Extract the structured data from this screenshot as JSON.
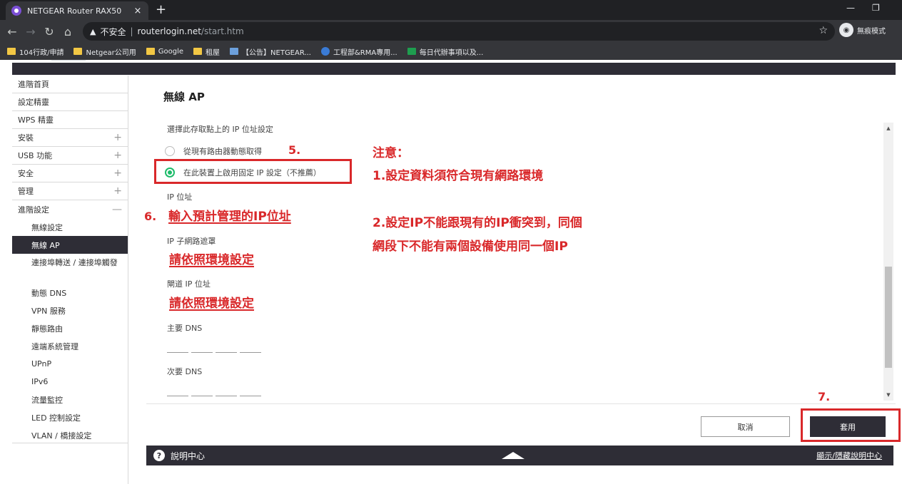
{
  "browser": {
    "tab_title": "NETGEAR Router RAX50",
    "tab_close": "×",
    "new_tab": "+",
    "minimize": "—",
    "maximize": "❐",
    "insecure_label": "不安全",
    "separator": "|",
    "url_host": "routerlogin.net",
    "url_path": "/start.htm",
    "incognito_label": "無痕模式",
    "bookmarks": [
      {
        "label": "104行政/申請",
        "icon": "folder"
      },
      {
        "label": "Netgear公司用",
        "icon": "folder"
      },
      {
        "label": "Google",
        "icon": "folder"
      },
      {
        "label": "租屋",
        "icon": "folder"
      },
      {
        "label": "【公告】NETGEAR...",
        "icon": "doc"
      },
      {
        "label": "工程部&RMA專用...",
        "icon": "globe"
      },
      {
        "label": "每日代辦事項以及...",
        "icon": "sheet"
      }
    ]
  },
  "sidebar": {
    "items": [
      {
        "label": "進階首頁",
        "expandable": false
      },
      {
        "label": "設定精靈",
        "expandable": false
      },
      {
        "label": "WPS 精靈",
        "expandable": false
      },
      {
        "label": "安裝",
        "expandable": true
      },
      {
        "label": "USB 功能",
        "expandable": true
      },
      {
        "label": "安全",
        "expandable": true
      },
      {
        "label": "管理",
        "expandable": true
      },
      {
        "label": "進階設定",
        "expandable": true,
        "expanded": true
      }
    ],
    "plus_symbol": "+",
    "minus_symbol": "—",
    "sub_items": [
      "無線設定",
      "無線 AP",
      "連接埠轉送 / 連接埠觸發",
      "動態 DNS",
      "VPN 服務",
      "靜態路由",
      "遠端系統管理",
      "UPnP",
      "IPv6",
      "流量監控",
      "LED 控制設定",
      "VLAN / 橋接設定"
    ],
    "active_sub_item": "無線 AP"
  },
  "main": {
    "title": "無線 AP",
    "ip_setting_label": "選擇此存取點上的 IP 位址設定",
    "radio_dynamic": "從現有路由器動態取得",
    "radio_static": "在此裝置上啟用固定 IP 設定（不推薦）",
    "selected_radio": "static",
    "ip_label": "IP 位址",
    "subnet_label": "IP 子網路遮罩",
    "gateway_label": "閘道 IP 位址",
    "dns_primary_label": "主要 DNS",
    "dns_secondary_label": "次要 DNS"
  },
  "annotations": {
    "step5": "5.",
    "step6": "6.",
    "step7": "7.",
    "ip_hint": "輸入預計管理的IP位址",
    "subnet_hint": "請依照環境設定",
    "gateway_hint": "請依照環境設定",
    "note_title": "注意：",
    "note_1": "1.設定資料須符合現有網路環境",
    "note_2_line1": "2.設定IP不能跟現有的IP衝突到，同個",
    "note_2_line2": "網段下不能有兩個設備使用同一個IP",
    "color": "#d9282a"
  },
  "buttons": {
    "cancel": "取消",
    "apply": "套用"
  },
  "help_bar": {
    "icon": "?",
    "label": "說明中心",
    "toggle": "顯示/隱藏說明中心"
  },
  "colors": {
    "brand_dark": "#2e2d36",
    "radio_selected": "#1dbb6a",
    "chrome_dark": "#202124"
  }
}
